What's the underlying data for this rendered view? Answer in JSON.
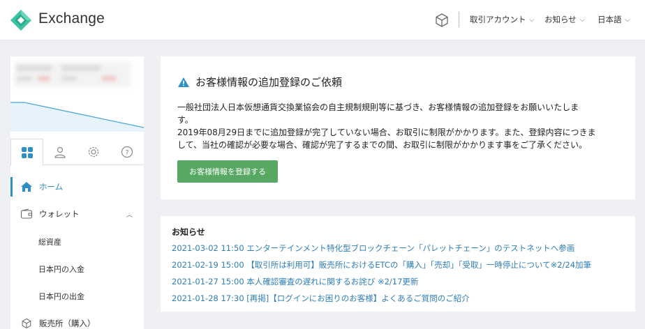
{
  "header": {
    "brand": "Exchange",
    "nav": [
      {
        "label": "取引アカウント"
      },
      {
        "label": "お知らせ"
      },
      {
        "label": "日本語"
      }
    ]
  },
  "sidebar": {
    "items": [
      {
        "label": "ホーム",
        "icon": "home-icon",
        "active": true
      },
      {
        "label": "ウォレット",
        "icon": "wallet-icon"
      },
      {
        "label": "販売所（購入）",
        "icon": "cube-icon"
      }
    ],
    "wallet_sub": [
      "総資産",
      "日本円の入金",
      "日本円の出金"
    ]
  },
  "notice": {
    "title": "お客様情報の追加登録のご依頼",
    "body1": "一般社団法人日本仮想通貨交換業協会の自主規制規則等に基づき、お客様情報の追加登録をお願いいたしま",
    "body2": "す。",
    "body3": "2019年08月29日までに追加登録が完了していない場合、お取引に制限がかかります。また、登録内容につきま",
    "body4": "して、当社の確認が必要な場合、確認が完了するまでの間、お取引に制限がかかります事をご了承ください。",
    "button": "お客様情報を登録する"
  },
  "news": {
    "title": "お知らせ",
    "items": [
      "2021-03-02 11:50 エンターテインメント特化型ブロックチェーン「パレットチェーン」のテストネットへ参画",
      "2021-02-19 15:00 【取引所は利用可】販売所におけるETCの「購入」「売却」「受取」一時停止について※2/24加筆",
      "2021-01-27 15:00 本人確認審査の遅れに関するお詫び ※2/17更新",
      "2021-01-28 17:30 [再掲]【ログインにお困りのお客様】よくあるご質問のご紹介"
    ]
  },
  "colors": {
    "accent": "#2d8fc4",
    "button": "#56a862",
    "link": "#2d7eb8",
    "logo": "#3ec3a2"
  }
}
